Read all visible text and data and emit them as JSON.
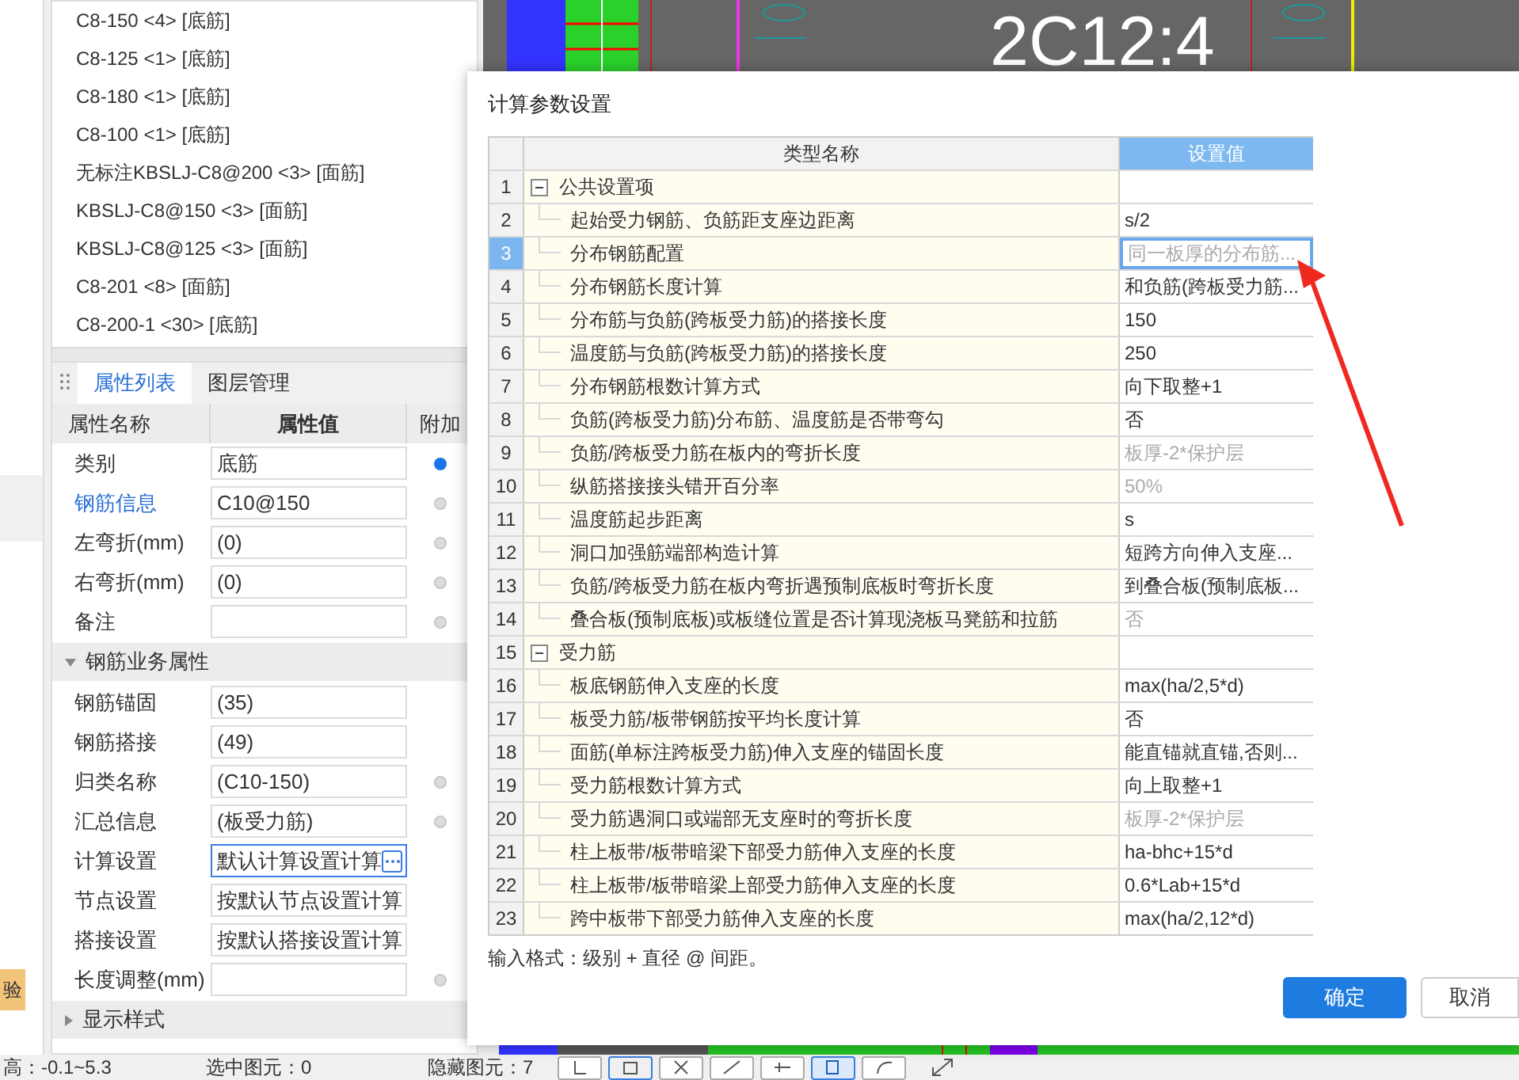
{
  "canvas": {
    "label": "2C12:4"
  },
  "rebar_list": {
    "items": [
      "C8-150 <4> [底筋]",
      "C8-125 <1> [底筋]",
      "C8-180 <1> [底筋]",
      "C8-100 <1> [底筋]",
      "无标注KBSLJ-C8@200 <3> [面筋]",
      "KBSLJ-C8@150 <3> [面筋]",
      "KBSLJ-C8@125 <3> [面筋]",
      "C8-201 <8> [面筋]",
      "C8-200-1 <30> [底筋]"
    ]
  },
  "side_tag": {
    "label": "验"
  },
  "property_panel": {
    "tabs": [
      {
        "label": "属性列表",
        "selected": true
      },
      {
        "label": "图层管理",
        "selected": false
      }
    ],
    "columns": [
      "属性名称",
      "属性值",
      "附加"
    ],
    "rows": [
      {
        "kind": "property",
        "name": "类别",
        "value": "底筋",
        "link": false,
        "focused": false,
        "attached": true
      },
      {
        "kind": "property",
        "name": "钢筋信息",
        "value": "C10@150",
        "link": true,
        "focused": false,
        "attached": false
      },
      {
        "kind": "property",
        "name": "左弯折(mm)",
        "value": "(0)",
        "link": false,
        "focused": false,
        "attached": false
      },
      {
        "kind": "property",
        "name": "右弯折(mm)",
        "value": "(0)",
        "link": false,
        "focused": false,
        "attached": false
      },
      {
        "kind": "property",
        "name": "备注",
        "link": false,
        "focused": false,
        "attached": false
      },
      {
        "kind": "section",
        "name": "钢筋业务属性",
        "expanded": true
      },
      {
        "kind": "property",
        "name": "钢筋锚固",
        "value": "(35)",
        "link": false,
        "focused": false
      },
      {
        "kind": "property",
        "name": "钢筋搭接",
        "value": "(49)",
        "link": false,
        "focused": false
      },
      {
        "kind": "property",
        "name": "归类名称",
        "value": "(C10-150)",
        "link": false,
        "focused": false,
        "attached": false
      },
      {
        "kind": "property",
        "name": "汇总信息",
        "value": "(板受力筋)",
        "link": false,
        "focused": false,
        "attached": false
      },
      {
        "kind": "property",
        "name": "计算设置",
        "value": "默认计算设置计算",
        "link": false,
        "focused": true
      },
      {
        "kind": "property",
        "name": "节点设置",
        "value": "按默认节点设置计算",
        "link": false,
        "focused": false
      },
      {
        "kind": "property",
        "name": "搭接设置",
        "value": "按默认搭接设置计算",
        "link": false,
        "focused": false
      },
      {
        "kind": "property",
        "name": "长度调整(mm)",
        "link": false,
        "focused": false,
        "attached": false
      },
      {
        "kind": "section",
        "name": "显示样式",
        "expanded": false
      }
    ]
  },
  "dialog": {
    "title": "计算参数设置",
    "columns": [
      "类型名称",
      "设置值"
    ],
    "rows": [
      {
        "number": "1",
        "kind": "group",
        "name": "公共设置项",
        "expanded": true,
        "selected": false
      },
      {
        "number": "2",
        "kind": "item",
        "name": "起始受力钢筋、负筋距支座边距离",
        "value": "s/2",
        "muted": false,
        "selected": false
      },
      {
        "number": "3",
        "kind": "item",
        "name": "分布钢筋配置",
        "value": "同一板厚的分布筋...",
        "muted": true,
        "selected": true
      },
      {
        "number": "4",
        "kind": "item",
        "name": "分布钢筋长度计算",
        "value": "和负筋(跨板受力筋...",
        "muted": false,
        "selected": false
      },
      {
        "number": "5",
        "kind": "item",
        "name": "分布筋与负筋(跨板受力筋)的搭接长度",
        "value": "150",
        "muted": false,
        "selected": false
      },
      {
        "number": "6",
        "kind": "item",
        "name": "温度筋与负筋(跨板受力筋)的搭接长度",
        "value": "250",
        "muted": false,
        "selected": false
      },
      {
        "number": "7",
        "kind": "item",
        "name": "分布钢筋根数计算方式",
        "value": "向下取整+1",
        "muted": false,
        "selected": false
      },
      {
        "number": "8",
        "kind": "item",
        "name": "负筋(跨板受力筋)分布筋、温度筋是否带弯勾",
        "value": "否",
        "muted": false,
        "selected": false
      },
      {
        "number": "9",
        "kind": "item",
        "name": "负筋/跨板受力筋在板内的弯折长度",
        "value": "板厚-2*保护层",
        "muted": true,
        "selected": false
      },
      {
        "number": "10",
        "kind": "item",
        "name": "纵筋搭接接头错开百分率",
        "value": "50%",
        "muted": true,
        "selected": false
      },
      {
        "number": "11",
        "kind": "item",
        "name": "温度筋起步距离",
        "value": "s",
        "muted": false,
        "selected": false
      },
      {
        "number": "12",
        "kind": "item",
        "name": "洞口加强筋端部构造计算",
        "value": "短跨方向伸入支座...",
        "muted": false,
        "selected": false
      },
      {
        "number": "13",
        "kind": "item",
        "name": "负筋/跨板受力筋在板内弯折遇预制底板时弯折长度",
        "value": "到叠合板(预制底板...",
        "muted": false,
        "selected": false
      },
      {
        "number": "14",
        "kind": "item",
        "name": "叠合板(预制底板)或板缝位置是否计算现浇板马凳筋和拉筋",
        "value": "否",
        "muted": true,
        "selected": false
      },
      {
        "number": "15",
        "kind": "group",
        "name": "受力筋",
        "expanded": true,
        "selected": false
      },
      {
        "number": "16",
        "kind": "item",
        "name": "板底钢筋伸入支座的长度",
        "value": "max(ha/2,5*d)",
        "muted": false,
        "selected": false
      },
      {
        "number": "17",
        "kind": "item",
        "name": "板受力筋/板带钢筋按平均长度计算",
        "value": "否",
        "muted": false,
        "selected": false
      },
      {
        "number": "18",
        "kind": "item",
        "name": "面筋(单标注跨板受力筋)伸入支座的锚固长度",
        "value": "能直锚就直锚,否则...",
        "muted": false,
        "selected": false
      },
      {
        "number": "19",
        "kind": "item",
        "name": "受力筋根数计算方式",
        "value": "向上取整+1",
        "muted": false,
        "selected": false
      },
      {
        "number": "20",
        "kind": "item",
        "name": "受力筋遇洞口或端部无支座时的弯折长度",
        "value": "板厚-2*保护层",
        "muted": true,
        "selected": false
      },
      {
        "number": "21",
        "kind": "item",
        "name": "柱上板带/板带暗梁下部受力筋伸入支座的长度",
        "value": "ha-bhc+15*d",
        "muted": false,
        "selected": false
      },
      {
        "number": "22",
        "kind": "item",
        "name": "柱上板带/板带暗梁上部受力筋伸入支座的长度",
        "value": "0.6*Lab+15*d",
        "muted": false,
        "selected": false
      },
      {
        "number": "23",
        "kind": "item",
        "name": "跨中板带下部受力筋伸入支座的长度",
        "value": "max(ha/2,12*d)",
        "muted": false,
        "selected": false
      }
    ],
    "hint": "输入格式：级别 + 直径 @ 间距。",
    "buttons": [
      {
        "label": "确定",
        "primary": true
      },
      {
        "label": "取消",
        "primary": false
      }
    ]
  },
  "status_bar": [
    "高：-0.1~5.3",
    "选中图元：0",
    "隐藏图元：7"
  ]
}
